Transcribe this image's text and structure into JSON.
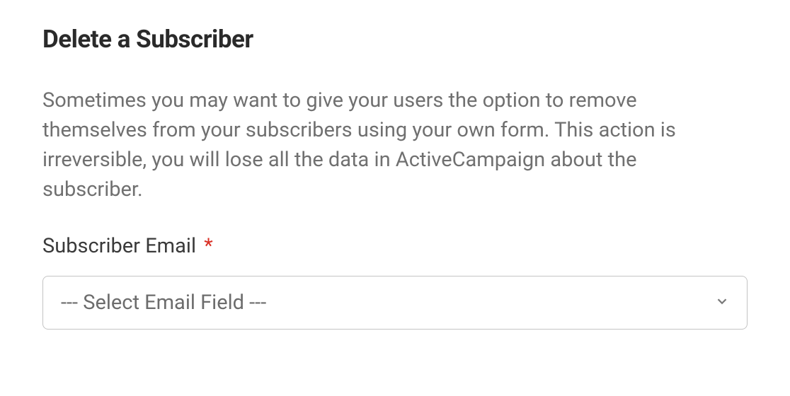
{
  "heading": "Delete a Subscriber",
  "description": "Sometimes you may want to give your users the option to remove themselves from your subscribers using your own form. This action is irreversible, you will lose all the data in ActiveCampaign about the subscriber.",
  "field": {
    "label": "Subscriber Email",
    "required_mark": "*",
    "select": {
      "placeholder": "--- Select Email Field ---"
    }
  }
}
